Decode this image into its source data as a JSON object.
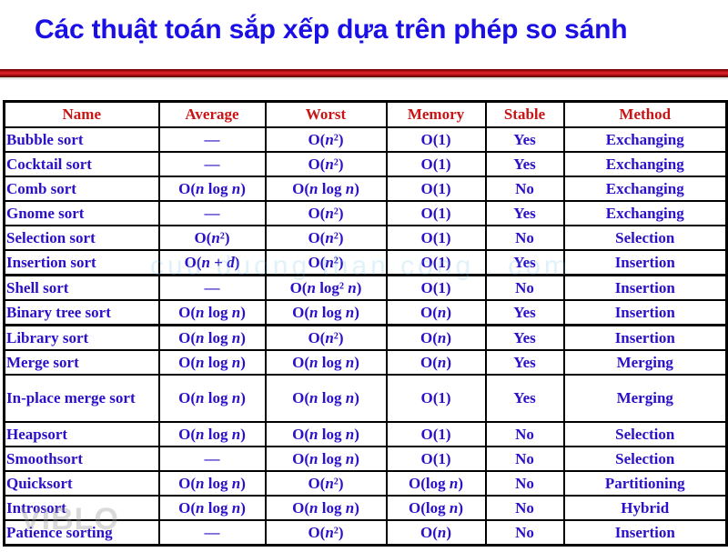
{
  "title": "Các thuật toán sắp xếp dựa trên phép so sánh",
  "watermarks": {
    "center": "cuu duong than cong . com",
    "logo": "VIBLO"
  },
  "colors": {
    "title": "#1a10e6",
    "header_text": "#c81414",
    "cell_text": "#2a10c8",
    "rule": "#c0141a"
  },
  "table": {
    "headers": [
      "Name",
      "Average",
      "Worst",
      "Memory",
      "Stable",
      "Method"
    ],
    "rows": [
      {
        "name": "Bubble sort",
        "average": "—",
        "worst": "O(n²)",
        "memory": "O(1)",
        "stable": "Yes",
        "method": "Exchanging"
      },
      {
        "name": "Cocktail sort",
        "average": "—",
        "worst": "O(n²)",
        "memory": "O(1)",
        "stable": "Yes",
        "method": "Exchanging"
      },
      {
        "name": "Comb sort",
        "average": "O(n log n)",
        "worst": "O(n log n)",
        "memory": "O(1)",
        "stable": "No",
        "method": "Exchanging"
      },
      {
        "name": "Gnome sort",
        "average": "—",
        "worst": "O(n²)",
        "memory": "O(1)",
        "stable": "Yes",
        "method": "Exchanging"
      },
      {
        "name": "Selection sort",
        "average": "O(n²)",
        "worst": "O(n²)",
        "memory": "O(1)",
        "stable": "No",
        "method": "Selection"
      },
      {
        "name": "Insertion sort",
        "average": "O(n + d)",
        "worst": "O(n²)",
        "memory": "O(1)",
        "stable": "Yes",
        "method": "Insertion"
      },
      {
        "name": "Shell sort",
        "average": "—",
        "worst": "O(n log² n)",
        "memory": "O(1)",
        "stable": "No",
        "method": "Insertion"
      },
      {
        "name": "Binary tree sort",
        "average": "O(n log n)",
        "worst": "O(n log n)",
        "memory": "O(n)",
        "stable": "Yes",
        "method": "Insertion"
      },
      {
        "name": "Library sort",
        "average": "O(n log n)",
        "worst": "O(n²)",
        "memory": "O(n)",
        "stable": "Yes",
        "method": "Insertion"
      },
      {
        "name": "Merge sort",
        "average": "O(n log n)",
        "worst": "O(n log n)",
        "memory": "O(n)",
        "stable": "Yes",
        "method": "Merging"
      },
      {
        "name": "In-place merge sort",
        "average": "O(n log n)",
        "worst": "O(n log n)",
        "memory": "O(1)",
        "stable": "Yes",
        "method": "Merging"
      },
      {
        "name": "Heapsort",
        "average": "O(n log n)",
        "worst": "O(n log n)",
        "memory": "O(1)",
        "stable": "No",
        "method": "Selection"
      },
      {
        "name": "Smoothsort",
        "average": "—",
        "worst": "O(n log n)",
        "memory": "O(1)",
        "stable": "No",
        "method": "Selection"
      },
      {
        "name": "Quicksort",
        "average": "O(n log n)",
        "worst": "O(n²)",
        "memory": "O(log n)",
        "stable": "No",
        "method": "Partitioning"
      },
      {
        "name": "Introsort",
        "average": "O(n log n)",
        "worst": "O(n log n)",
        "memory": "O(log n)",
        "stable": "No",
        "method": "Hybrid"
      },
      {
        "name": "Patience sorting",
        "average": "—",
        "worst": "O(n²)",
        "memory": "O(n)",
        "stable": "No",
        "method": "Insertion"
      }
    ]
  }
}
